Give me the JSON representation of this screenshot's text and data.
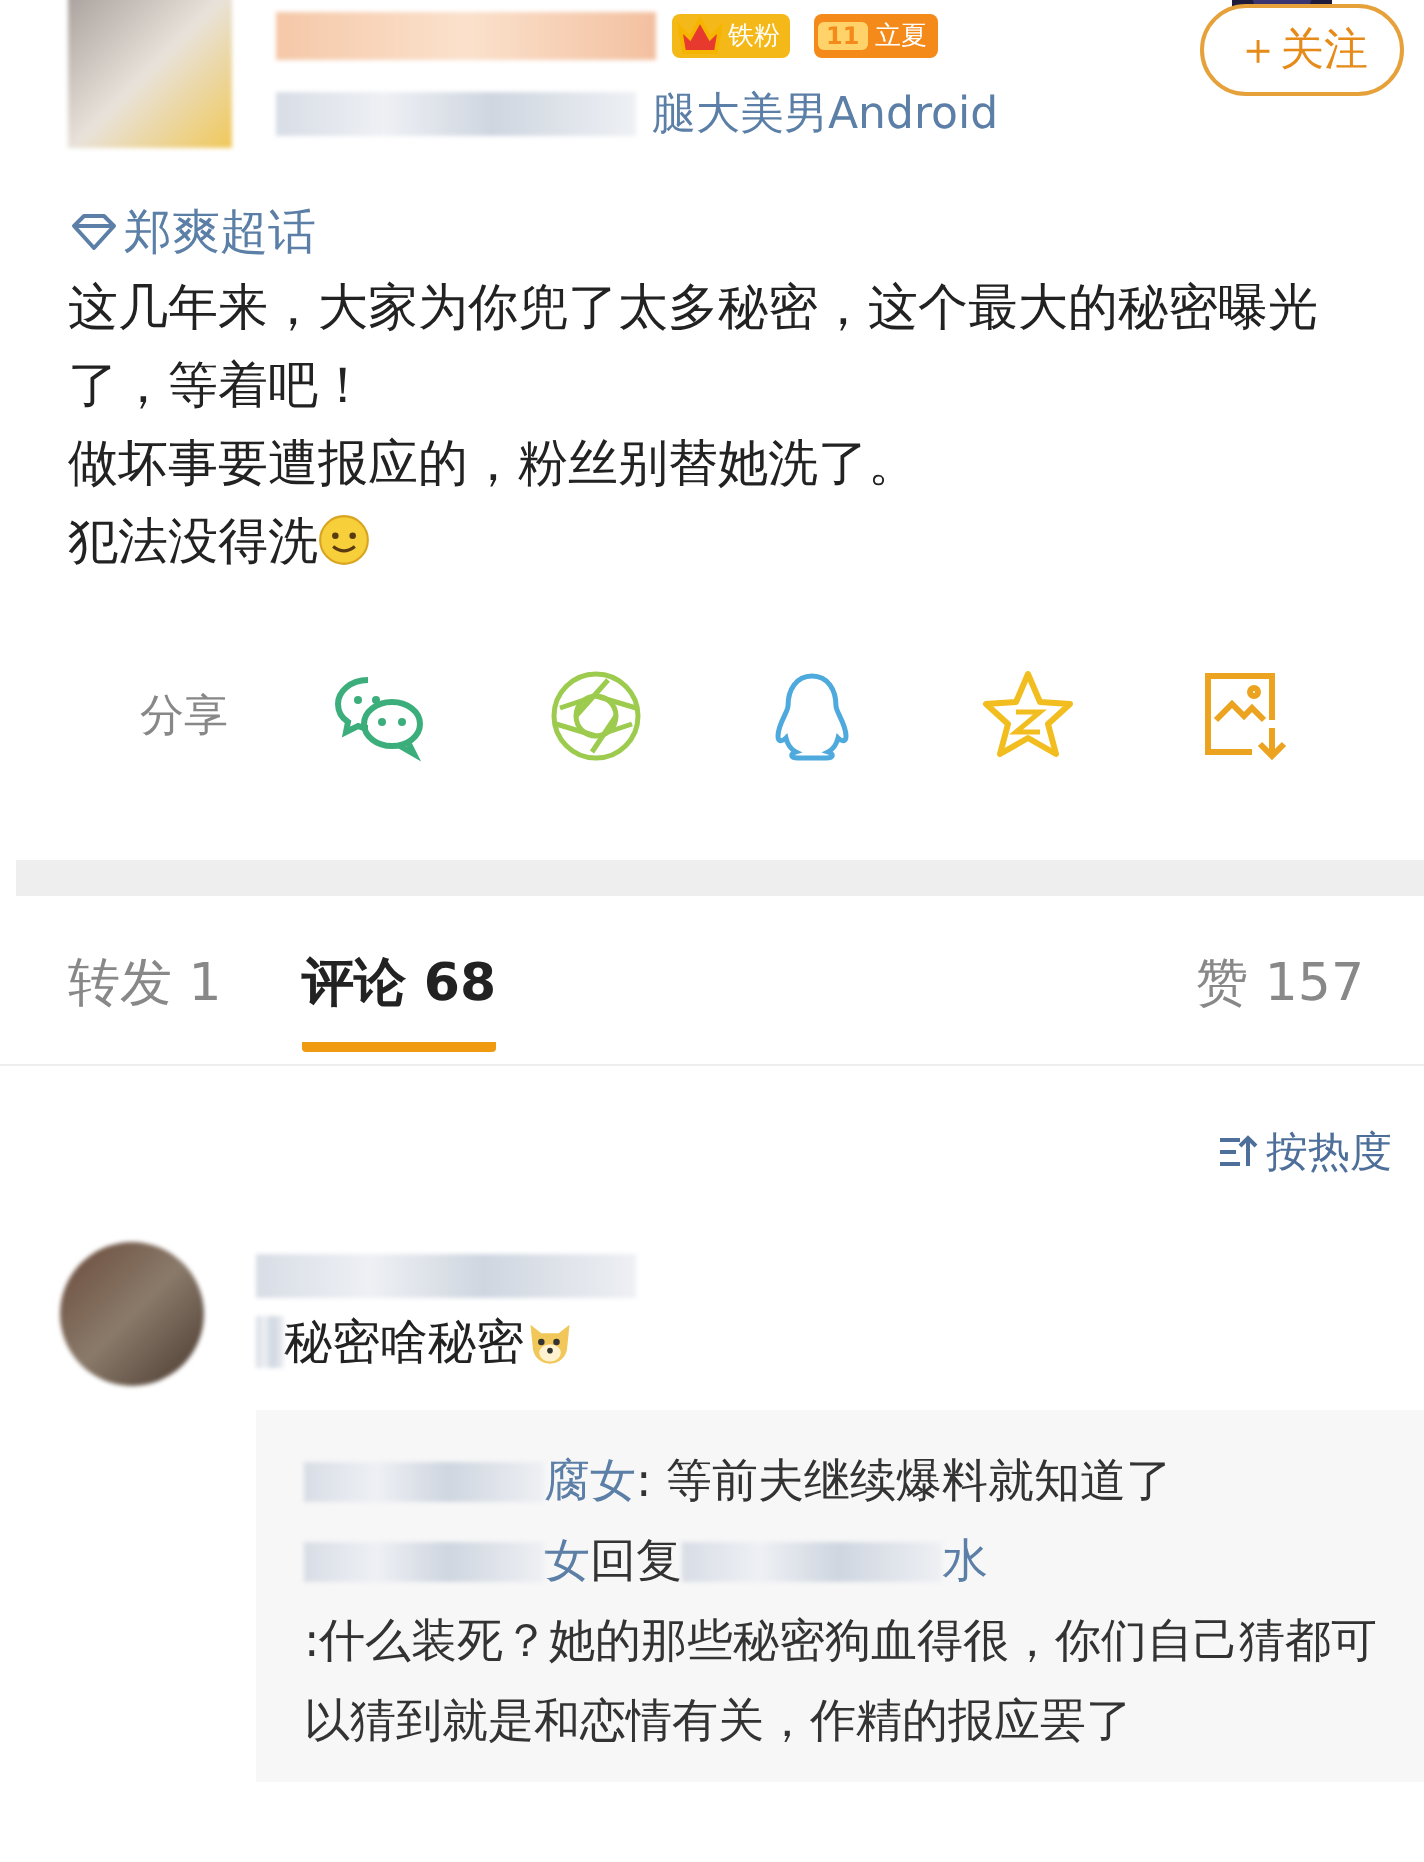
{
  "post": {
    "badges": [
      {
        "kind": "fan",
        "label": "铁粉"
      },
      {
        "kind": "level",
        "number": "11",
        "label": "立夏"
      }
    ],
    "source": "腿大美男Android",
    "follow": "＋关注",
    "topic": "郑爽超话",
    "lines": [
      "这几年来，大家为你兜了太多秘密，这个最大的秘密曝光了，等着吧！",
      "做坏事要遭报应的，粉丝别替她洗了。",
      "犯法没得洗"
    ]
  },
  "share": {
    "label": "分享",
    "targets": [
      {
        "kind": "wechat"
      },
      {
        "kind": "moments"
      },
      {
        "kind": "qq"
      },
      {
        "kind": "qzone"
      },
      {
        "kind": "save"
      }
    ]
  },
  "tabs": [
    {
      "label": "转发 1",
      "selected": false
    },
    {
      "label": "评论 68",
      "selected": true
    }
  ],
  "likes": "赞 157",
  "sort": "按热度",
  "comments": [
    {
      "text": "秘密啥秘密",
      "replies": [
        {
          "name": "腐女",
          "body": ": 等前夫继续爆料就知道了"
        },
        {
          "name": "女",
          "reply_word": "回复",
          "target": "水",
          "body": ":什么装死？她的那些秘密狗血得很，你们自己猜都可以猜到就是和恋情有关，作精的报应罢了"
        }
      ]
    }
  ]
}
